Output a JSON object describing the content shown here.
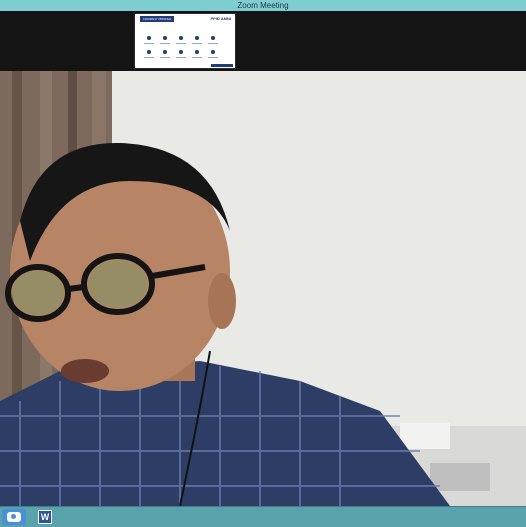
{
  "window": {
    "title": "Zoom Meeting"
  },
  "shared_screen": {
    "banner": "COMPANY PROFILE",
    "logo": "PPID AMNI"
  },
  "taskbar": {
    "zoom_icon": "zoom-icon",
    "word_icon": "word-icon",
    "word_letter": "W"
  }
}
